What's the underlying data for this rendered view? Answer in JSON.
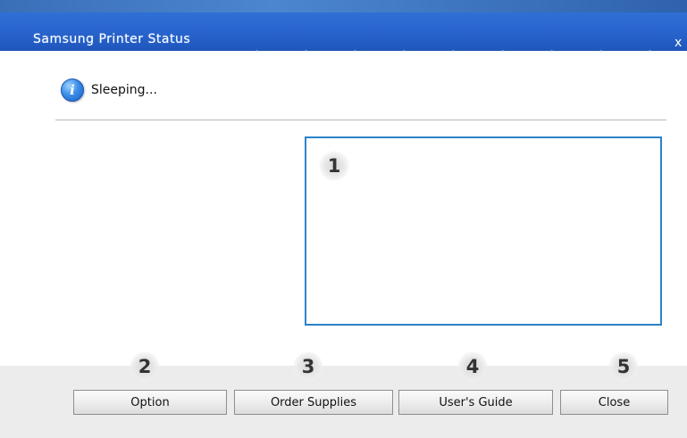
{
  "window": {
    "title": "Samsung Printer Status",
    "close_glyph": "x"
  },
  "status": {
    "icon": "info-icon",
    "text": "Sleeping..."
  },
  "callouts": {
    "panel": "1",
    "option": "2",
    "order_supplies": "3",
    "users_guide": "4",
    "close": "5"
  },
  "buttons": {
    "option": "Option",
    "order_supplies": "Order Supplies",
    "users_guide": "User's Guide",
    "close": "Close"
  },
  "colors": {
    "title_bar": "#2a66cf",
    "panel_border": "#2b82c9",
    "footer": "#ececec"
  }
}
